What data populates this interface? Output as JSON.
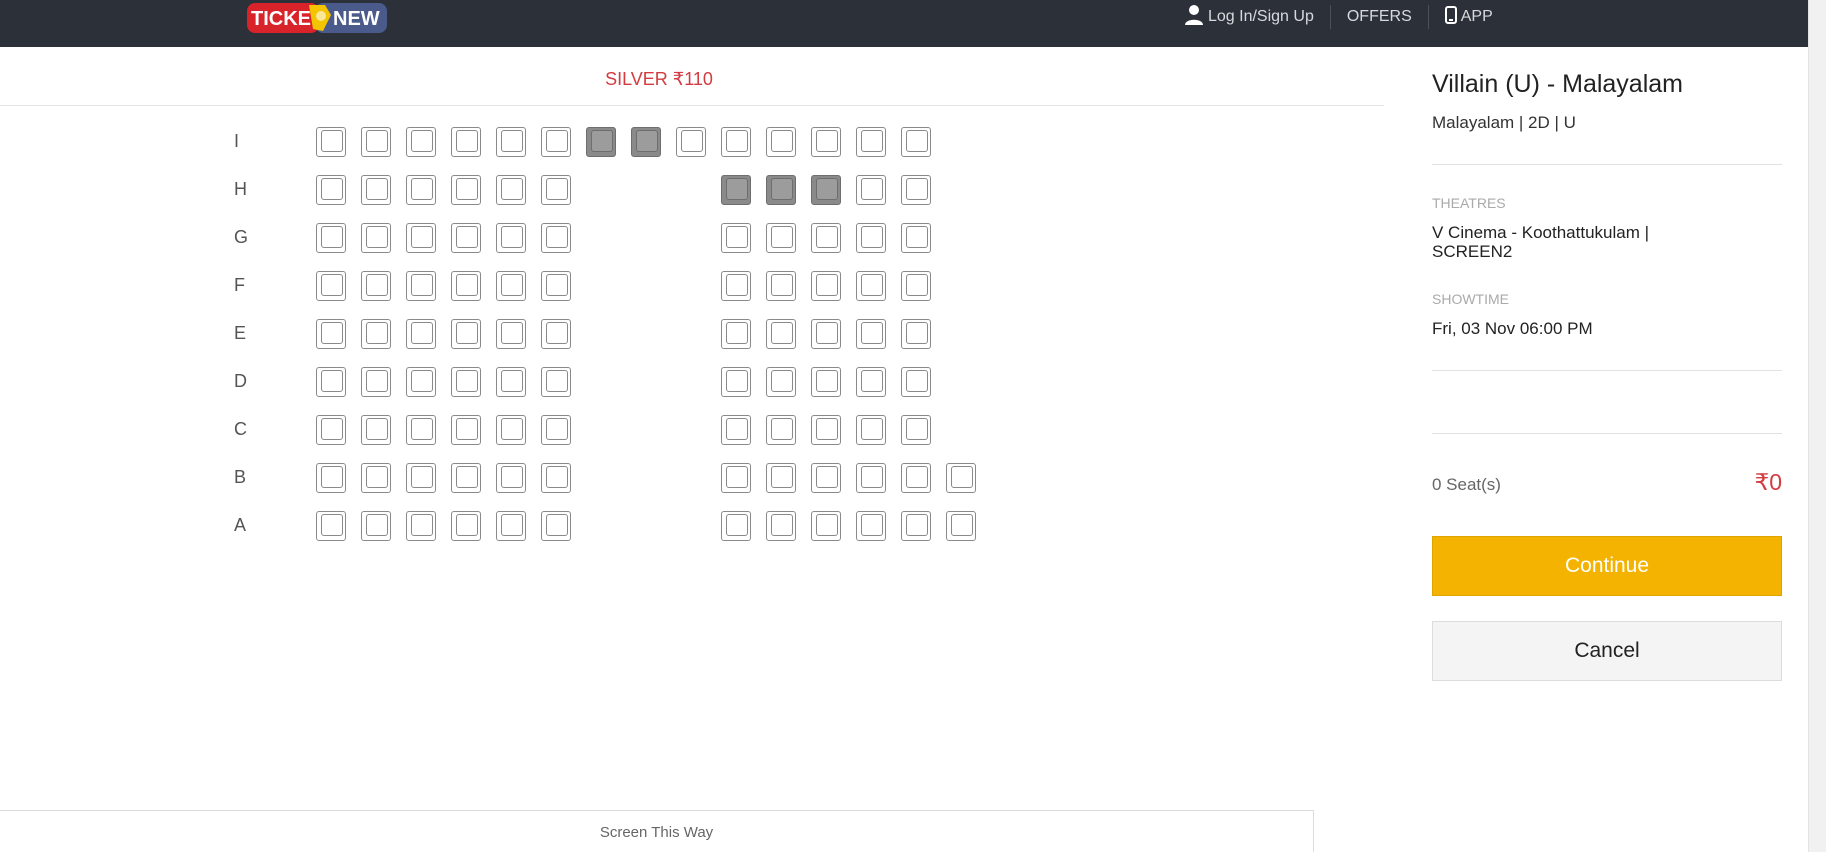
{
  "nav": {
    "logo_text_left": "TICKE",
    "logo_text_right": "NEW",
    "login_label": "Log In/Sign Up",
    "offers_label": "OFFERS",
    "app_label": "APP"
  },
  "seating": {
    "section_label": "SILVER ₹110",
    "screen_label": "Screen This Way",
    "rows": [
      {
        "label": "I",
        "seats": [
          {
            "status": "available"
          },
          {
            "status": "available"
          },
          {
            "status": "available"
          },
          {
            "status": "available"
          },
          {
            "status": "available"
          },
          {
            "status": "available"
          },
          {
            "status": "booked"
          },
          {
            "status": "booked"
          },
          {
            "status": "available"
          },
          {
            "status": "available"
          },
          {
            "status": "available"
          },
          {
            "status": "available"
          },
          {
            "status": "available"
          },
          {
            "status": "available"
          }
        ]
      },
      {
        "label": "H",
        "seats": [
          {
            "status": "available"
          },
          {
            "status": "available"
          },
          {
            "status": "available"
          },
          {
            "status": "available"
          },
          {
            "status": "available"
          },
          {
            "status": "available"
          },
          null,
          null,
          null,
          {
            "status": "booked"
          },
          {
            "status": "booked"
          },
          {
            "status": "booked"
          },
          {
            "status": "available"
          },
          {
            "status": "available"
          }
        ]
      },
      {
        "label": "G",
        "seats": [
          {
            "status": "available"
          },
          {
            "status": "available"
          },
          {
            "status": "available"
          },
          {
            "status": "available"
          },
          {
            "status": "available"
          },
          {
            "status": "available"
          },
          null,
          null,
          null,
          {
            "status": "available"
          },
          {
            "status": "available"
          },
          {
            "status": "available"
          },
          {
            "status": "available"
          },
          {
            "status": "available"
          }
        ]
      },
      {
        "label": "F",
        "seats": [
          {
            "status": "available"
          },
          {
            "status": "available"
          },
          {
            "status": "available"
          },
          {
            "status": "available"
          },
          {
            "status": "available"
          },
          {
            "status": "available"
          },
          null,
          null,
          null,
          {
            "status": "available"
          },
          {
            "status": "available"
          },
          {
            "status": "available"
          },
          {
            "status": "available"
          },
          {
            "status": "available"
          }
        ]
      },
      {
        "label": "E",
        "seats": [
          {
            "status": "available"
          },
          {
            "status": "available"
          },
          {
            "status": "available"
          },
          {
            "status": "available"
          },
          {
            "status": "available"
          },
          {
            "status": "available"
          },
          null,
          null,
          null,
          {
            "status": "available"
          },
          {
            "status": "available"
          },
          {
            "status": "available"
          },
          {
            "status": "available"
          },
          {
            "status": "available"
          }
        ]
      },
      {
        "label": "D",
        "seats": [
          {
            "status": "available"
          },
          {
            "status": "available"
          },
          {
            "status": "available"
          },
          {
            "status": "available"
          },
          {
            "status": "available"
          },
          {
            "status": "available"
          },
          null,
          null,
          null,
          {
            "status": "available"
          },
          {
            "status": "available"
          },
          {
            "status": "available"
          },
          {
            "status": "available"
          },
          {
            "status": "available"
          }
        ]
      },
      {
        "label": "C",
        "seats": [
          {
            "status": "available"
          },
          {
            "status": "available"
          },
          {
            "status": "available"
          },
          {
            "status": "available"
          },
          {
            "status": "available"
          },
          {
            "status": "available"
          },
          null,
          null,
          null,
          {
            "status": "available"
          },
          {
            "status": "available"
          },
          {
            "status": "available"
          },
          {
            "status": "available"
          },
          {
            "status": "available"
          }
        ]
      },
      {
        "label": "B",
        "seats": [
          {
            "status": "available"
          },
          {
            "status": "available"
          },
          {
            "status": "available"
          },
          {
            "status": "available"
          },
          {
            "status": "available"
          },
          {
            "status": "available"
          },
          null,
          null,
          null,
          {
            "status": "available"
          },
          {
            "status": "available"
          },
          {
            "status": "available"
          },
          {
            "status": "available"
          },
          {
            "status": "available"
          },
          {
            "status": "available"
          }
        ]
      },
      {
        "label": "A",
        "seats": [
          {
            "status": "available"
          },
          {
            "status": "available"
          },
          {
            "status": "available"
          },
          {
            "status": "available"
          },
          {
            "status": "available"
          },
          {
            "status": "available"
          },
          null,
          null,
          null,
          {
            "status": "available"
          },
          {
            "status": "available"
          },
          {
            "status": "available"
          },
          {
            "status": "available"
          },
          {
            "status": "available"
          },
          {
            "status": "available"
          }
        ]
      }
    ]
  },
  "summary": {
    "movie_title": "Villain (U) - Malayalam",
    "movie_meta": "Malayalam | 2D | U",
    "theatres_label": "THEATRES",
    "theatre_name": "V Cinema - Koothattukulam | SCREEN2",
    "showtime_label": "SHOWTIME",
    "showtime_value": "Fri, 03 Nov 06:00 PM",
    "seat_count": "0 Seat(s)",
    "total_price": "₹0",
    "continue_label": "Continue",
    "cancel_label": "Cancel"
  },
  "colors": {
    "nav_bg": "#2c3039",
    "accent_red": "#d33b40",
    "continue_yellow": "#f3b300",
    "booked_seat": "#8a8a8a"
  }
}
